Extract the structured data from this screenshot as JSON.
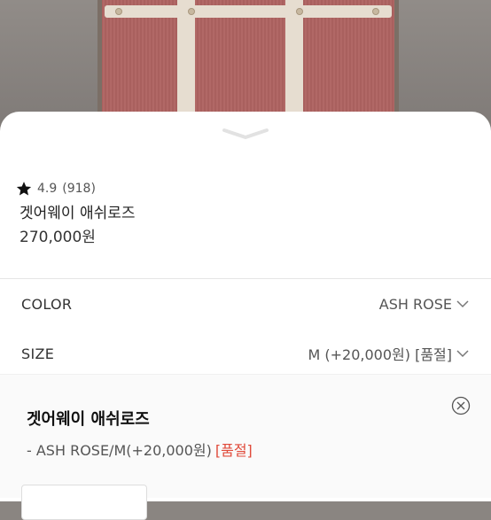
{
  "product": {
    "rating": "4.9",
    "review_count": "(918)",
    "name": "겟어웨이 애쉬로즈",
    "price": "270,000원"
  },
  "options": [
    {
      "label": "COLOR",
      "value": "ASH ROSE"
    },
    {
      "label": "SIZE",
      "value": "M (+20,000원) [품절]"
    }
  ],
  "selected_item": {
    "name": "겟어웨이 애쉬로즈",
    "detail": "- ASH ROSE/M(+20,000원)",
    "status": "[품절]"
  },
  "colors": {
    "accent_soldout": "#e04a3a",
    "bag_fabric": "#b16866",
    "strap": "#e6ddd0"
  },
  "icons": [
    "star-icon",
    "chevron-down-icon",
    "close-circle-icon",
    "sheet-handle-icon"
  ]
}
